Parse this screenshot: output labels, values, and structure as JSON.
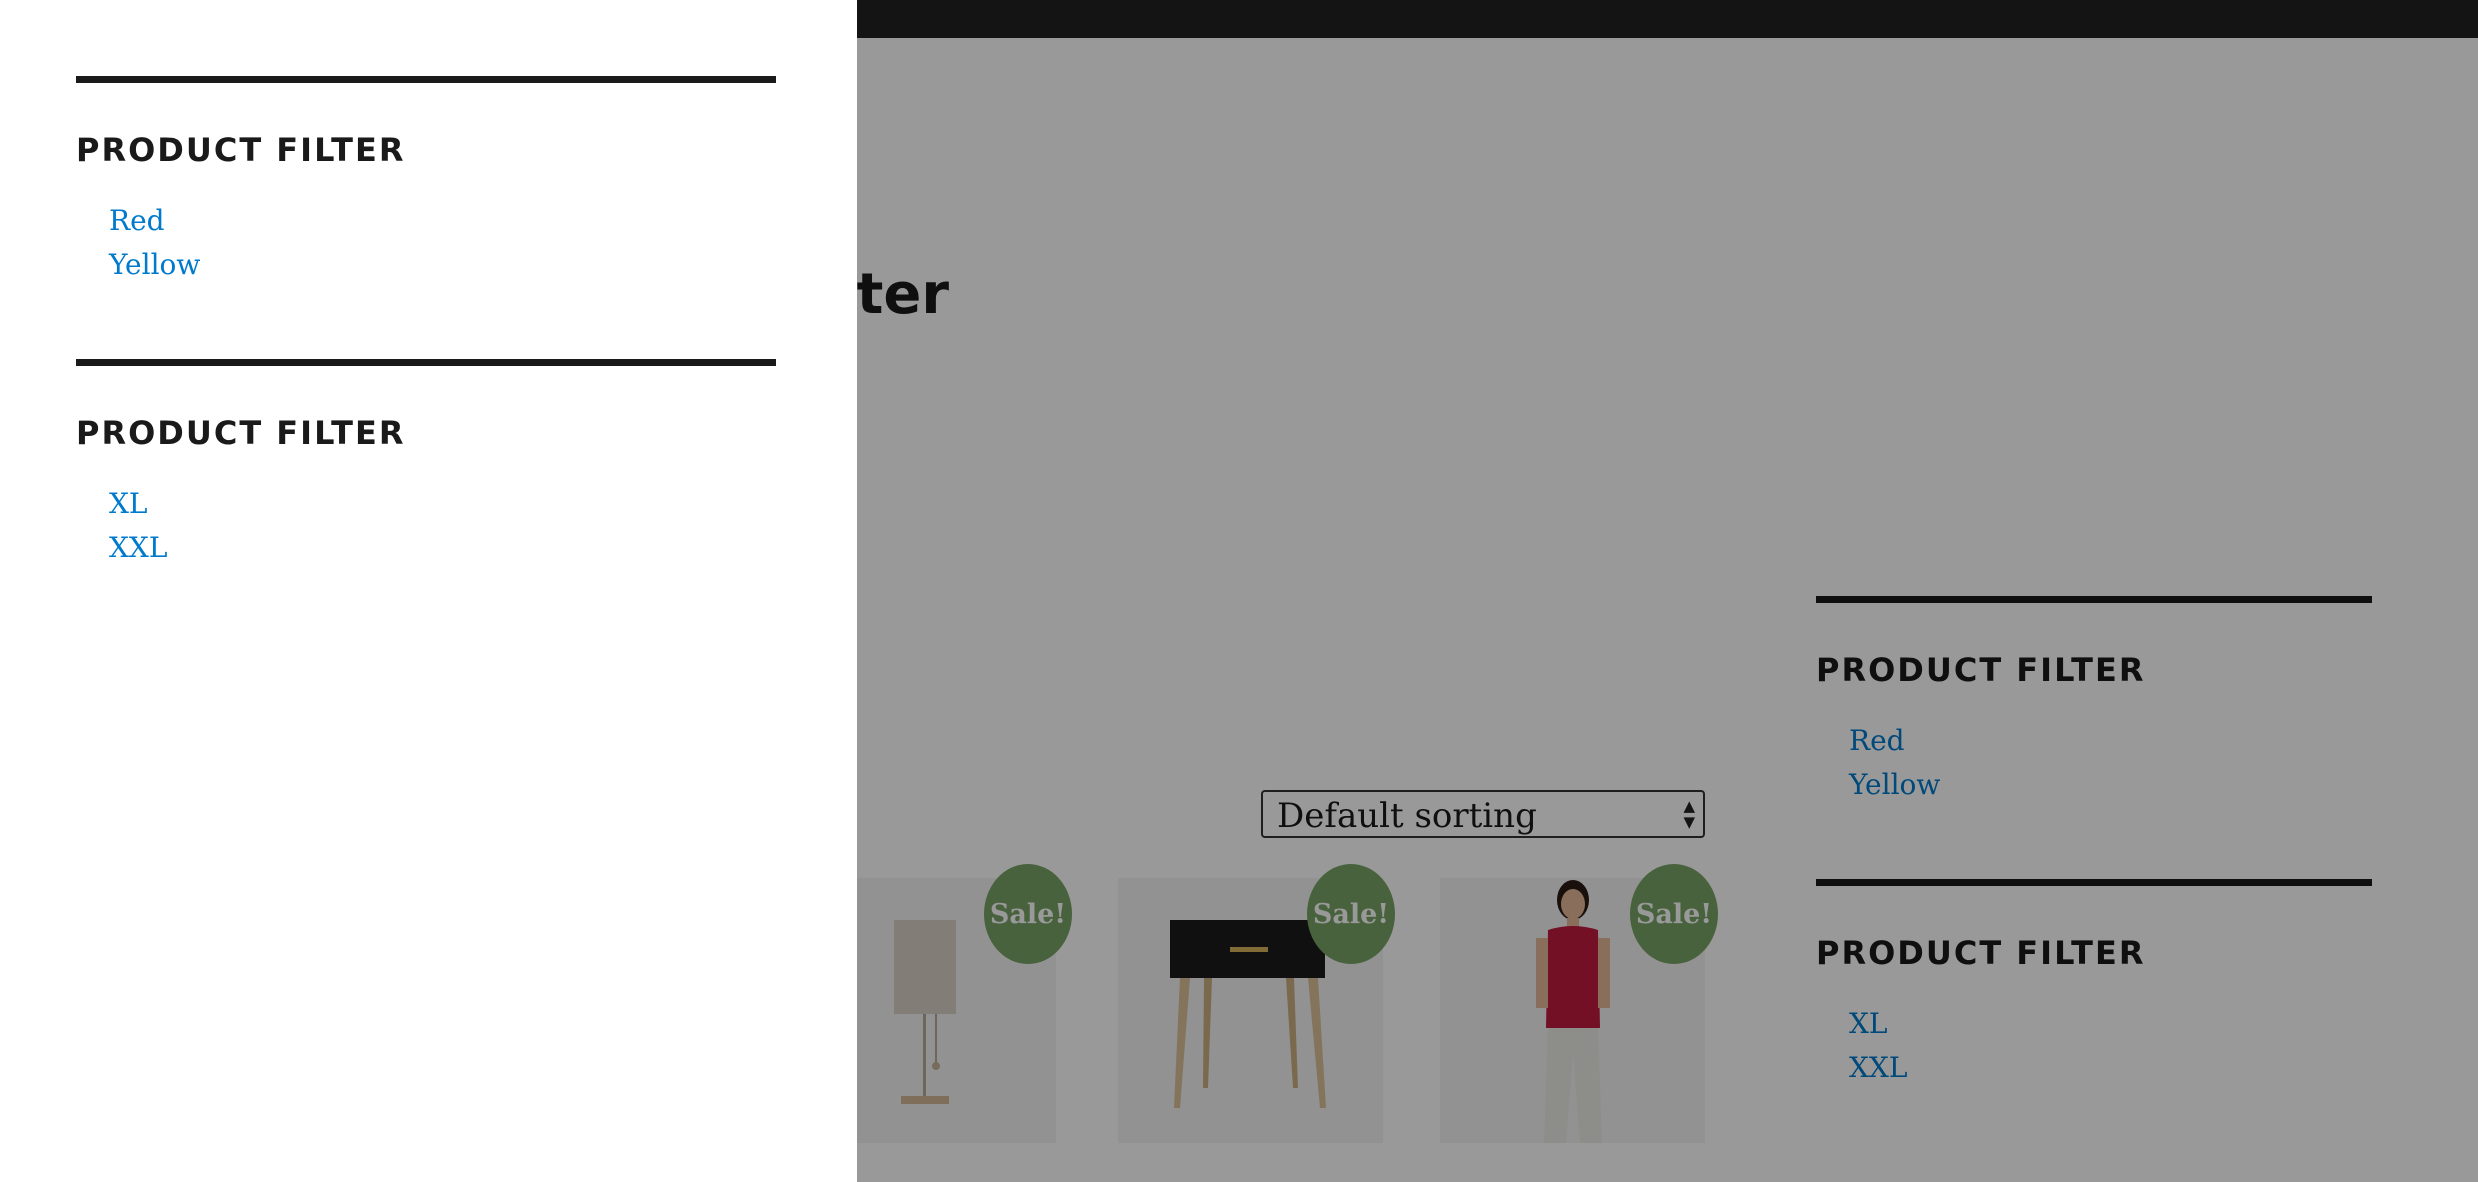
{
  "page": {
    "title": "Filter"
  },
  "sorting": {
    "selected": "Default sorting"
  },
  "products": [
    {
      "badge": "Sale!",
      "icon": "lamp-image"
    },
    {
      "badge": "Sale!",
      "icon": "side-table-image"
    },
    {
      "badge": "Sale!",
      "icon": "woman-red-top-image"
    }
  ],
  "sidebar": {
    "widgets": [
      {
        "title": "PRODUCT FILTER",
        "links": [
          "Red",
          "Yellow"
        ]
      },
      {
        "title": "PRODUCT FILTER",
        "links": [
          "XL",
          "XXL"
        ]
      }
    ]
  },
  "drawer": {
    "widgets": [
      {
        "title": "PRODUCT FILTER",
        "links": [
          "Red",
          "Yellow"
        ]
      },
      {
        "title": "PRODUCT FILTER",
        "links": [
          "XL",
          "XXL"
        ]
      }
    ]
  },
  "colors": {
    "link": "#007acc",
    "sale_badge": "#77a464",
    "admin_bar": "#222222",
    "overlay": "rgba(0,0,0,0.4)"
  }
}
